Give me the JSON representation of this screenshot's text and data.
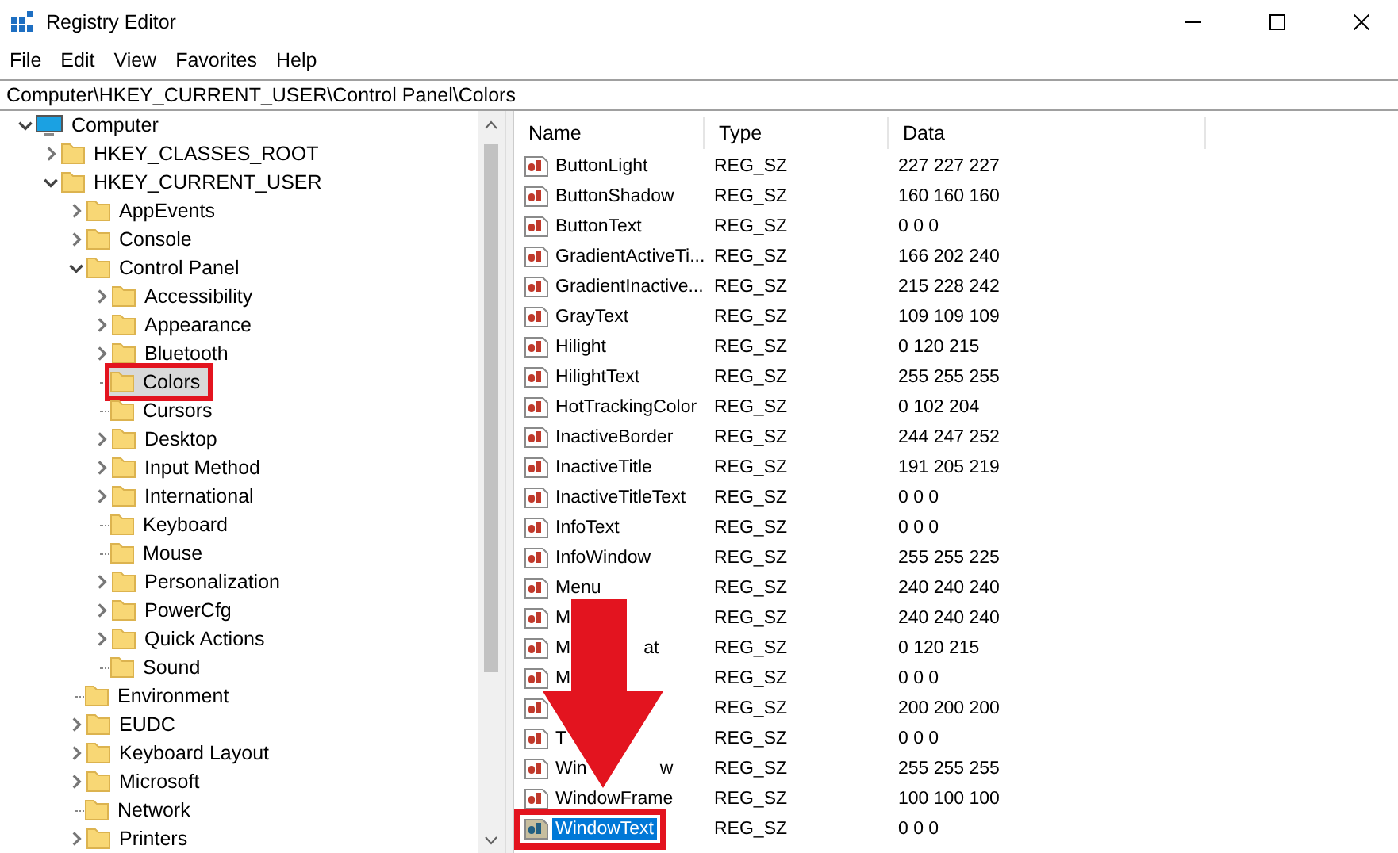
{
  "window": {
    "title": "Registry Editor"
  },
  "menu": [
    "File",
    "Edit",
    "View",
    "Favorites",
    "Help"
  ],
  "address": "Computer\\HKEY_CURRENT_USER\\Control Panel\\Colors",
  "tree": [
    {
      "label": "Computer",
      "kind": "computer",
      "expandable": true,
      "expanded": true,
      "selected": false,
      "outlined": false,
      "children": [
        {
          "label": "HKEY_CLASSES_ROOT",
          "kind": "folder",
          "expandable": true,
          "expanded": false,
          "selected": false,
          "outlined": false
        },
        {
          "label": "HKEY_CURRENT_USER",
          "kind": "folder",
          "expandable": true,
          "expanded": true,
          "selected": false,
          "outlined": false,
          "children": [
            {
              "label": "AppEvents",
              "kind": "folder",
              "expandable": true,
              "expanded": false,
              "selected": false,
              "outlined": false
            },
            {
              "label": "Console",
              "kind": "folder",
              "expandable": true,
              "expanded": false,
              "selected": false,
              "outlined": false
            },
            {
              "label": "Control Panel",
              "kind": "folder",
              "expandable": true,
              "expanded": true,
              "selected": false,
              "outlined": false,
              "children": [
                {
                  "label": "Accessibility",
                  "kind": "folder",
                  "expandable": true,
                  "expanded": false,
                  "selected": false,
                  "outlined": false
                },
                {
                  "label": "Appearance",
                  "kind": "folder",
                  "expandable": true,
                  "expanded": false,
                  "selected": false,
                  "outlined": false
                },
                {
                  "label": "Bluetooth",
                  "kind": "folder",
                  "expandable": true,
                  "expanded": false,
                  "selected": false,
                  "outlined": false
                },
                {
                  "label": "Colors",
                  "kind": "folder",
                  "expandable": false,
                  "selected": true,
                  "outlined": true
                },
                {
                  "label": "Cursors",
                  "kind": "folder",
                  "expandable": false,
                  "selected": false,
                  "outlined": false
                },
                {
                  "label": "Desktop",
                  "kind": "folder",
                  "expandable": true,
                  "expanded": false,
                  "selected": false,
                  "outlined": false
                },
                {
                  "label": "Input Method",
                  "kind": "folder",
                  "expandable": true,
                  "expanded": false,
                  "selected": false,
                  "outlined": false
                },
                {
                  "label": "International",
                  "kind": "folder",
                  "expandable": true,
                  "expanded": false,
                  "selected": false,
                  "outlined": false
                },
                {
                  "label": "Keyboard",
                  "kind": "folder",
                  "expandable": false,
                  "selected": false,
                  "outlined": false
                },
                {
                  "label": "Mouse",
                  "kind": "folder",
                  "expandable": false,
                  "selected": false,
                  "outlined": false
                },
                {
                  "label": "Personalization",
                  "kind": "folder",
                  "expandable": true,
                  "expanded": false,
                  "selected": false,
                  "outlined": false
                },
                {
                  "label": "PowerCfg",
                  "kind": "folder",
                  "expandable": true,
                  "expanded": false,
                  "selected": false,
                  "outlined": false
                },
                {
                  "label": "Quick Actions",
                  "kind": "folder",
                  "expandable": true,
                  "expanded": false,
                  "selected": false,
                  "outlined": false
                },
                {
                  "label": "Sound",
                  "kind": "folder",
                  "expandable": false,
                  "selected": false,
                  "outlined": false
                }
              ]
            },
            {
              "label": "Environment",
              "kind": "folder",
              "expandable": false,
              "selected": false,
              "outlined": false
            },
            {
              "label": "EUDC",
              "kind": "folder",
              "expandable": true,
              "expanded": false,
              "selected": false,
              "outlined": false
            },
            {
              "label": "Keyboard Layout",
              "kind": "folder",
              "expandable": true,
              "expanded": false,
              "selected": false,
              "outlined": false
            },
            {
              "label": "Microsoft",
              "kind": "folder",
              "expandable": true,
              "expanded": false,
              "selected": false,
              "outlined": false
            },
            {
              "label": "Network",
              "kind": "folder",
              "expandable": false,
              "selected": false,
              "outlined": false
            },
            {
              "label": "Printers",
              "kind": "folder",
              "expandable": true,
              "expanded": false,
              "selected": false,
              "outlined": false
            }
          ]
        }
      ]
    }
  ],
  "table": {
    "columns": [
      "Name",
      "Type",
      "Data"
    ],
    "rows": [
      {
        "name": "ButtonLight",
        "type": "REG_SZ",
        "data": "227 227 227",
        "selected": false,
        "outlined": false
      },
      {
        "name": "ButtonShadow",
        "type": "REG_SZ",
        "data": "160 160 160",
        "selected": false,
        "outlined": false
      },
      {
        "name": "ButtonText",
        "type": "REG_SZ",
        "data": "0 0 0",
        "selected": false,
        "outlined": false
      },
      {
        "name": "GradientActiveTi...",
        "type": "REG_SZ",
        "data": "166 202 240",
        "selected": false,
        "outlined": false
      },
      {
        "name": "GradientInactive...",
        "type": "REG_SZ",
        "data": "215 228 242",
        "selected": false,
        "outlined": false
      },
      {
        "name": "GrayText",
        "type": "REG_SZ",
        "data": "109 109 109",
        "selected": false,
        "outlined": false
      },
      {
        "name": "Hilight",
        "type": "REG_SZ",
        "data": "0 120 215",
        "selected": false,
        "outlined": false
      },
      {
        "name": "HilightText",
        "type": "REG_SZ",
        "data": "255 255 255",
        "selected": false,
        "outlined": false
      },
      {
        "name": "HotTrackingColor",
        "type": "REG_SZ",
        "data": "0 102 204",
        "selected": false,
        "outlined": false
      },
      {
        "name": "InactiveBorder",
        "type": "REG_SZ",
        "data": "244 247 252",
        "selected": false,
        "outlined": false
      },
      {
        "name": "InactiveTitle",
        "type": "REG_SZ",
        "data": "191 205 219",
        "selected": false,
        "outlined": false
      },
      {
        "name": "InactiveTitleText",
        "type": "REG_SZ",
        "data": "0 0 0",
        "selected": false,
        "outlined": false
      },
      {
        "name": "InfoText",
        "type": "REG_SZ",
        "data": "0 0 0",
        "selected": false,
        "outlined": false
      },
      {
        "name": "InfoWindow",
        "type": "REG_SZ",
        "data": "255 255 225",
        "selected": false,
        "outlined": false
      },
      {
        "name": "Menu",
        "type": "REG_SZ",
        "data": "240 240 240",
        "selected": false,
        "outlined": false
      },
      {
        "name": "M",
        "type": "REG_SZ",
        "data": "240 240 240",
        "selected": false,
        "outlined": false
      },
      {
        "name": "M",
        "name_end": "at",
        "type": "REG_SZ",
        "data": "0 120 215",
        "selected": false,
        "outlined": false
      },
      {
        "name": "M",
        "type": "REG_SZ",
        "data": "0 0 0",
        "selected": false,
        "outlined": false
      },
      {
        "type": "REG_SZ",
        "data": "200 200 200",
        "selected": false
      },
      {
        "name": "T",
        "type": "REG_SZ",
        "data": "0 0 0",
        "selected": false,
        "outlined": false
      },
      {
        "name": "Win",
        "name_end": "w",
        "type": "REG_SZ",
        "data": "255 255 255",
        "selected": false,
        "outlined": false
      },
      {
        "name": "WindowFrame",
        "type": "REG_SZ",
        "data": "100 100 100",
        "selected": false,
        "outlined": false
      },
      {
        "name": "WindowText",
        "type": "REG_SZ",
        "data": "0 0 0",
        "selected": true,
        "outlined": true
      }
    ]
  },
  "overlay": {
    "kind": "arrow"
  }
}
